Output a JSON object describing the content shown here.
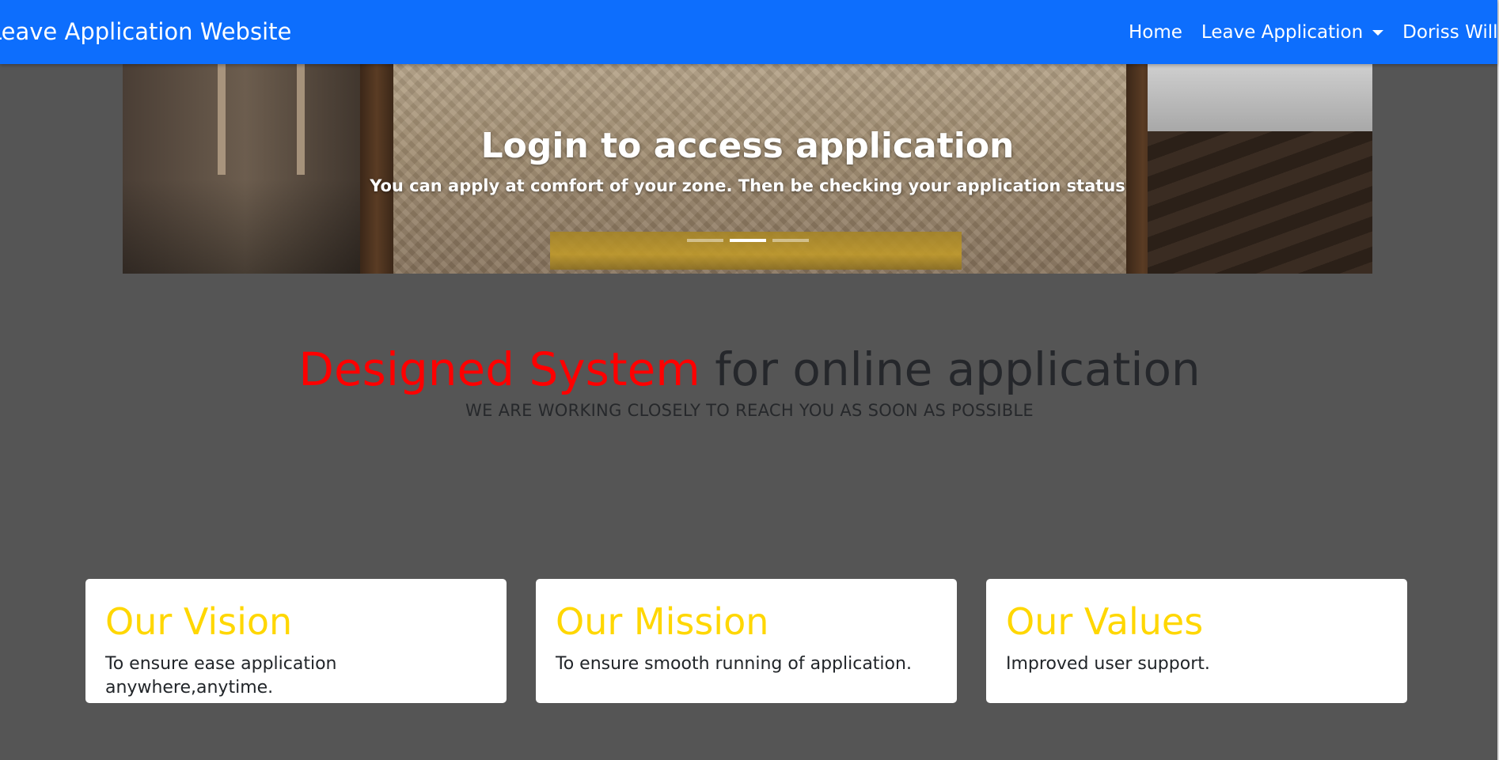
{
  "navbar": {
    "brand": "Leave Application Website",
    "links": [
      {
        "label": "Home"
      },
      {
        "label": "Leave Application",
        "dropdown": true
      },
      {
        "label": "Doriss Willies"
      }
    ]
  },
  "carousel": {
    "title": "Login to access application",
    "text": "You can apply at comfort of your zone. Then be checking your application status",
    "slide_count": 3,
    "active_slide": 2
  },
  "section": {
    "title_accent": "Designed System",
    "title_rest": " for online application",
    "subtitle": "WE ARE WORKING CLOSELY TO REACH YOU AS SOON AS POSSIBLE"
  },
  "cards": [
    {
      "title": "Our Vision",
      "text": "To ensure ease application anywhere,anytime."
    },
    {
      "title": "Our Mission",
      "text": "To ensure smooth running of application."
    },
    {
      "title": "Our Values",
      "text": "Improved user support."
    }
  ],
  "colors": {
    "navbar": "#0d6efd",
    "page_background": "#555555",
    "accent_red": "#ff0000",
    "card_title": "#ffd700",
    "card_background": "#ffffff"
  }
}
